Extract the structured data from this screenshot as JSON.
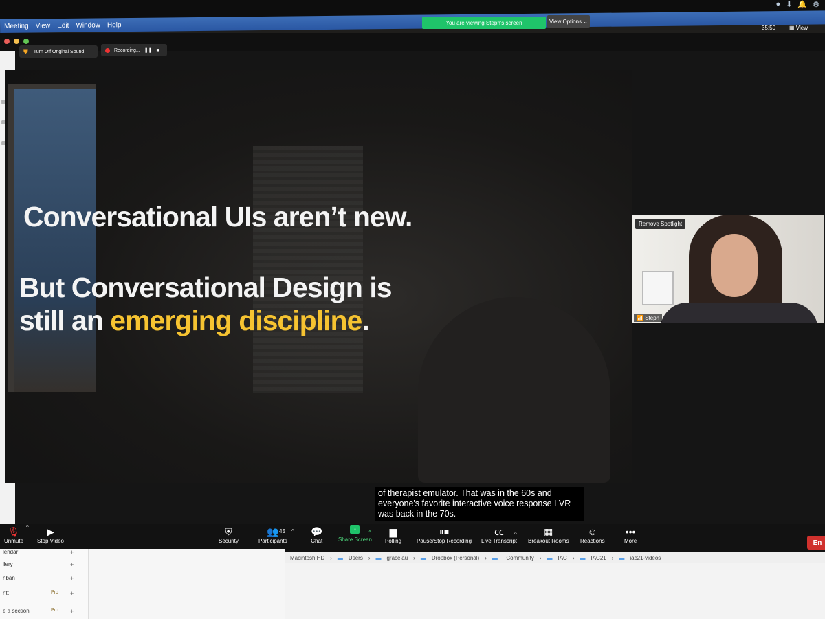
{
  "menu": {
    "items": [
      "Meeting",
      "View",
      "Edit",
      "Window",
      "Help"
    ]
  },
  "banner": {
    "viewing": "You are viewing Steph's screen",
    "view_options": "View Options ⌄"
  },
  "zoom_top": {
    "sound": "Turn Off Original Sound",
    "recording": "Recording...",
    "timer": "35:50",
    "view": "View"
  },
  "slide": {
    "line1": "Conversational UIs aren’t new.",
    "line2a": "But Conversational Design is",
    "line2b_plain": "still an ",
    "line2b_highlight": "emerging discipline",
    "line2b_end": "."
  },
  "caption": {
    "text": "of therapist emulator. That was in the 60s and everyone's favorite interactive voice response I VR was back in the 70s."
  },
  "participant": {
    "remove_spotlight": "Remove Spotlight",
    "name": "Steph"
  },
  "toolbar": {
    "unmute": "Unmute",
    "stop_video": "Stop Video",
    "security": "Security",
    "participants": "Participants",
    "participants_count": "45",
    "chat": "Chat",
    "share": "Share Screen",
    "polling": "Polling",
    "recording": "Pause/Stop Recording",
    "transcript": "Live Transcript",
    "breakout": "Breakout Rooms",
    "reactions": "Reactions",
    "more": "More",
    "end": "En"
  },
  "path": {
    "items": [
      "Macintosh HD",
      "Users",
      "gracelau",
      "Dropbox (Personal)",
      "_Community",
      "IAC",
      "IAC21",
      "iac21-videos"
    ]
  },
  "sidebar": {
    "items": [
      "lendar",
      "llery",
      "nban",
      "ntt",
      "e a section"
    ],
    "pro": "Pro"
  },
  "colors": {
    "accent_yellow": "#f6c331",
    "share_green": "#1fc46a",
    "end_red": "#d0312d"
  }
}
